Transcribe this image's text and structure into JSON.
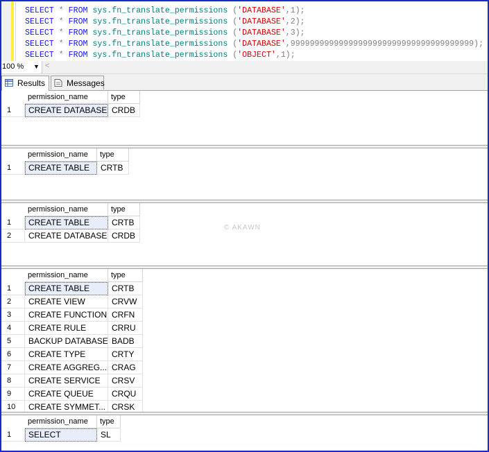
{
  "editor": {
    "lines": [
      {
        "keyword": "SELECT",
        "star": "*",
        "from": "FROM",
        "func": "sys.fn_translate_permissions",
        "open": " (",
        "arg1": "'DATABASE'",
        "rest": ",1);"
      },
      {
        "keyword": "SELECT",
        "star": "*",
        "from": "FROM",
        "func": "sys.fn_translate_permissions",
        "open": " (",
        "arg1": "'DATABASE'",
        "rest": ",2);"
      },
      {
        "keyword": "SELECT",
        "star": "*",
        "from": "FROM",
        "func": "sys.fn_translate_permissions",
        "open": " (",
        "arg1": "'DATABASE'",
        "rest": ",3);"
      },
      {
        "keyword": "SELECT",
        "star": "*",
        "from": "FROM",
        "func": "sys.fn_translate_permissions",
        "open": " (",
        "arg1": "'DATABASE'",
        "rest": ",99999999999999999999999999999999999999);"
      },
      {
        "keyword": "SELECT",
        "star": "*",
        "from": "FROM",
        "func": "sys.fn_translate_permissions",
        "open": " (",
        "arg1": "'OBJECT'",
        "rest": ",1);"
      }
    ]
  },
  "zoom": {
    "value": "100 %",
    "arrow": "▼",
    "scroll_left": "<"
  },
  "tabs": [
    {
      "label": "Results",
      "icon": "grid-icon"
    },
    {
      "label": "Messages",
      "icon": "document-icon"
    }
  ],
  "results": [
    {
      "headers": [
        "permission_name",
        "type"
      ],
      "rows": [
        [
          "1",
          "CREATE DATABASE",
          "CRDB"
        ]
      ]
    },
    {
      "headers": [
        "permission_name",
        "type"
      ],
      "rows": [
        [
          "1",
          "CREATE TABLE",
          "CRTB"
        ]
      ]
    },
    {
      "headers": [
        "permission_name",
        "type"
      ],
      "rows": [
        [
          "1",
          "CREATE TABLE",
          "CRTB"
        ],
        [
          "2",
          "CREATE DATABASE",
          "CRDB"
        ]
      ]
    },
    {
      "headers": [
        "permission_name",
        "type"
      ],
      "rows": [
        [
          "1",
          "CREATE TABLE",
          "CRTB"
        ],
        [
          "2",
          "CREATE VIEW",
          "CRVW"
        ],
        [
          "3",
          "CREATE FUNCTION",
          "CRFN"
        ],
        [
          "4",
          "CREATE RULE",
          "CRRU"
        ],
        [
          "5",
          "BACKUP DATABASE",
          "BADB"
        ],
        [
          "6",
          "CREATE TYPE",
          "CRTY"
        ],
        [
          "7",
          "CREATE AGGREG...",
          "CRAG"
        ],
        [
          "8",
          "CREATE SERVICE",
          "CRSV"
        ],
        [
          "9",
          "CREATE QUEUE",
          "CRQU"
        ],
        [
          "10",
          "CREATE SYMMET...",
          "CRSK"
        ]
      ]
    },
    {
      "headers": [
        "permission_name",
        "type"
      ],
      "rows": [
        [
          "1",
          "SELECT",
          "SL"
        ]
      ]
    }
  ],
  "watermark": "© AKAWN",
  "colors": {
    "keyword": "#1515ff",
    "function": "#008080",
    "string": "#e00000",
    "frame": "#1a2bc8"
  }
}
